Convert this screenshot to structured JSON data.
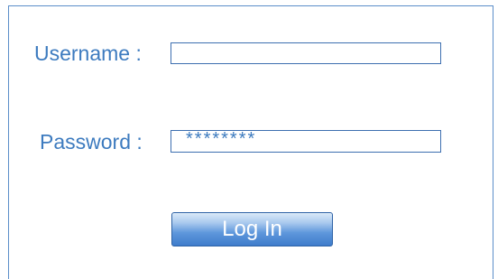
{
  "form": {
    "username_label": "Username :",
    "username_value": "",
    "password_label": "Password :",
    "password_value": "********",
    "login_label": "Log In"
  },
  "colors": {
    "label_text": "#3d7bbf",
    "border": "#5b8ec9",
    "button_top": "#dbe9f8",
    "button_bottom": "#3e7ccb"
  }
}
